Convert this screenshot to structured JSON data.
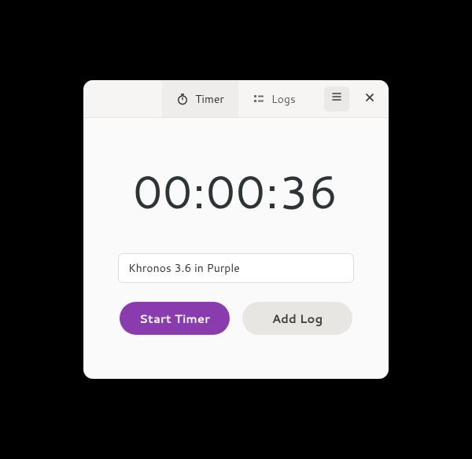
{
  "header": {
    "tabs": [
      {
        "id": "timer",
        "label": "Timer",
        "icon": "stopwatch-icon",
        "active": true
      },
      {
        "id": "logs",
        "label": "Logs",
        "icon": "list-icon",
        "active": false
      }
    ],
    "menu_icon": "hamburger-icon",
    "close_icon": "close-icon"
  },
  "timer": {
    "elapsed": "00:00:36",
    "task_name_value": "Khronos 3.6 in Purple"
  },
  "actions": {
    "start_label": "Start Timer",
    "addlog_label": "Add Log"
  },
  "colors": {
    "accent": "#8a3bad",
    "bg": "#fafafa",
    "btn_secondary": "#e8e6e3"
  }
}
